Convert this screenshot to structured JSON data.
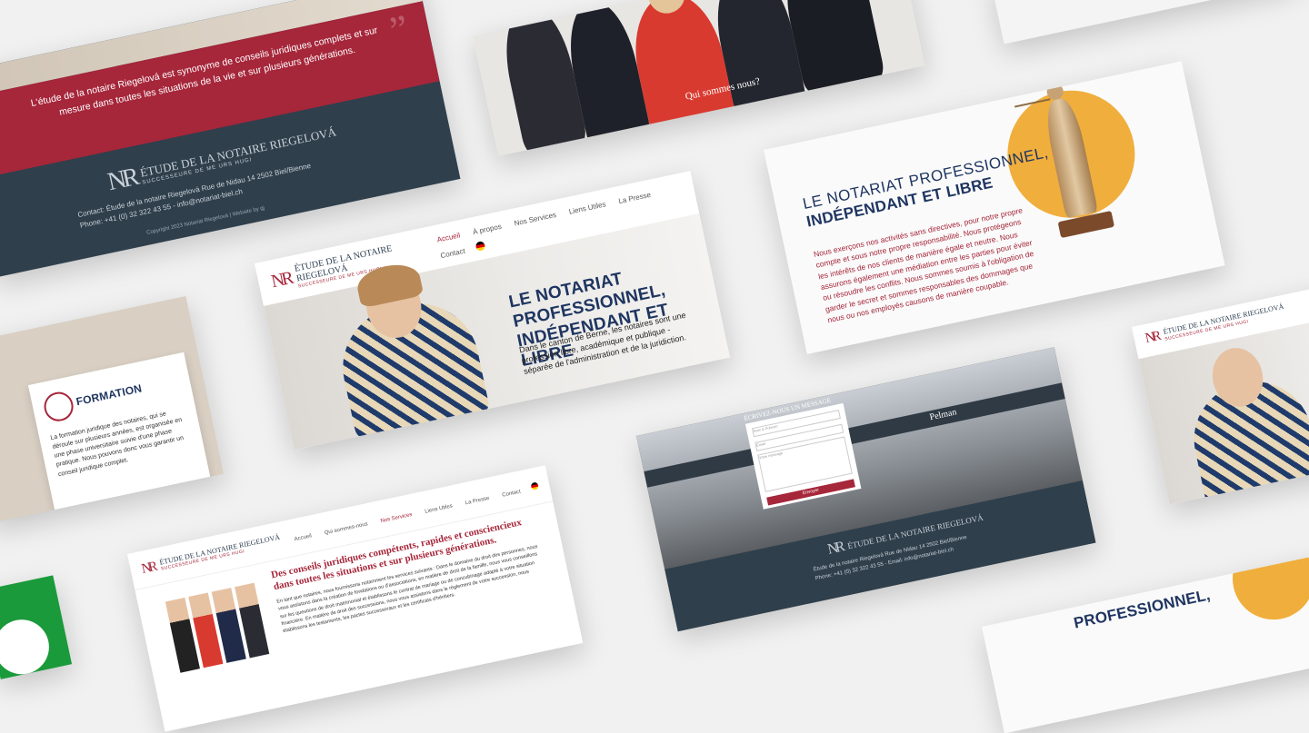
{
  "brand": {
    "monogram": "NR",
    "name": "ÉTUDE DE LA NOTAIRE RIEGELOVÁ",
    "tagline": "SUCCESSEURE DE ME URS HUGI"
  },
  "footer_card": {
    "quote": "L'étude de la notaire Riegelová est synonyme de conseils juridiques complets et sur mesure dans toutes les situations de la vie et sur plusieurs générations.",
    "contact_label": "Contact:",
    "address": "Étude de la notaire Riegelová Rue de Nidau 14 2502 Biel/Bienne",
    "phone_label": "Phone:",
    "phone": "+41 (0) 32 322 43 55",
    "email": "info@notariat-biel.ch",
    "copyright": "Copyright 2023 Notariat Riegelová | Website by gj"
  },
  "team_card": {
    "caption": "Qui sommes nous?"
  },
  "justice_card": {
    "title_line1": "LE NOTARIAT PROFESSIONNEL,",
    "title_line2": "INDÉPENDANT ET LIBRE",
    "body": "Nous exerçons nos activités sans directives, pour notre propre compte et sous notre propre responsabilité. Nous protégeons les intérêts de nos clients de manière égale et neutre. Nous assurons également une médiation entre les parties pour éviter ou résoudre les conflits. Nous sommes soumis à l'obligation de garder le secret et sommes responsables des dommages que nous ou nos employés causons de manière coupable."
  },
  "hero_card": {
    "nav": [
      "Accueil",
      "À propos",
      "Nos Services",
      "Liens Utiles",
      "La Presse",
      "Contact"
    ],
    "active_nav": "Accueil",
    "headline_line1": "LE NOTARIAT PROFESSIONNEL,",
    "headline_line2": "INDÉPENDANT ET LIBRE",
    "body": "Dans le canton de Berne, les notaires sont une profession libre, académique et publique - séparée de l'administration et de la juridiction."
  },
  "formation_card": {
    "title": "FORMATION",
    "body": "La formation juridique des notaires, qui se déroule sur plusieurs années, est organisée en une phase universitaire suivie d'une phase pratique. Nous pouvons donc vous garantir un conseil juridique complet."
  },
  "services_card": {
    "nav": [
      "Accueil",
      "Qui sommes-nous",
      "Nos Services",
      "Liens Utiles",
      "La Presse",
      "Contact"
    ],
    "active_nav": "Nos Services",
    "heading": "Des conseils juridiques compétents, rapides et consciencieux dans toutes les situations et sur plusieurs générations.",
    "body": "En tant que notaires, nous fournissons notamment les services suivants : Dans le domaine du droit des personnes, nous vous assistons dans la création de fondations ou d'associations, en matière de droit de la famille, nous vous conseillons sur les questions de droit matrimonial et établissons le contrat de mariage ou de concubinage adapté à votre situation financière. En matière de droit des successions, nous vous assistons dans le règlement de votre succession, nous établissons les testaments, les pactes successoraux et les certificats d'héritiers."
  },
  "contact_card": {
    "form_title": "ÉCRIVEZ-NOUS UN MESSAGE",
    "placeholders": [
      "Nom & Prénom",
      "Email",
      "Votre message"
    ],
    "submit": "Envoyer",
    "shop_sign": "Pelman",
    "contact_line1": "Étude de la notaire Riegelová Rue de Nidau 14 2502 Biel/Bienne",
    "contact_line2": "Phone: +41 (0) 32 322 43 55 - Email: info@notariat-biel.ch"
  },
  "partial_title": "PROFESSIONNEL,",
  "colors": {
    "brand_red": "#a6263a",
    "navy": "#2c3e50",
    "dark_slate": "#2f3f4c",
    "accent_orange": "#f0ae3c",
    "headline_navy": "#1f3561"
  }
}
